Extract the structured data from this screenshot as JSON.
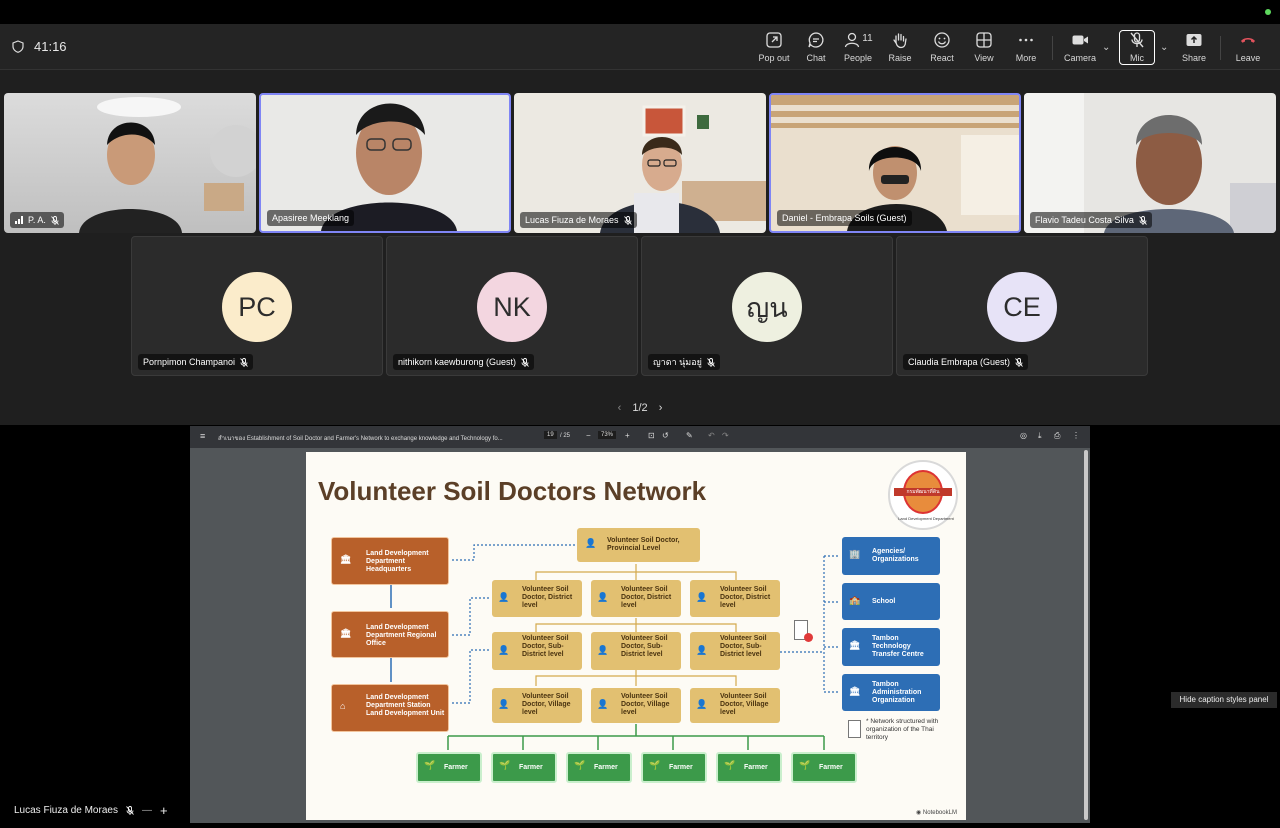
{
  "meeting": {
    "timer": "41:16",
    "pager": "1/2",
    "caption_tooltip": "Hide caption styles panel",
    "sharer_name": "Lucas Fiuza de Moraes"
  },
  "toolbar": [
    {
      "label": "Pop out",
      "icon": "pop-out-icon"
    },
    {
      "label": "Chat",
      "icon": "chat-icon"
    },
    {
      "label": "People",
      "icon": "people-icon",
      "count": "11"
    },
    {
      "label": "Raise",
      "icon": "raise-hand-icon"
    },
    {
      "label": "React",
      "icon": "react-icon"
    },
    {
      "label": "View",
      "icon": "view-icon"
    },
    {
      "label": "More",
      "icon": "more-icon"
    },
    {
      "label": "Camera",
      "icon": "camera-icon"
    },
    {
      "label": "Mic",
      "icon": "mic-off-icon"
    },
    {
      "label": "Share",
      "icon": "share-icon"
    },
    {
      "label": "Leave",
      "icon": "leave-icon"
    }
  ],
  "video_tiles": [
    {
      "name": "P. A.",
      "muted": true
    },
    {
      "name": "Apasiree Meeklang",
      "muted": false
    },
    {
      "name": "Lucas Fiuza de Moraes",
      "muted": true
    },
    {
      "name": "Daniel - Embrapa Soils (Guest)",
      "muted": false
    },
    {
      "name": "Flavio Tadeu Costa Silva",
      "muted": true
    }
  ],
  "avatar_tiles": [
    {
      "initials": "PC",
      "name": "Pornpimon Champanoi",
      "color": "#fbeccb"
    },
    {
      "initials": "NK",
      "name": "nithikorn kaewburong (Guest)",
      "color": "#f3d6e0"
    },
    {
      "initials": "ญน",
      "name": "ญาดา นุ่มอยู่",
      "color": "#eef0e0"
    },
    {
      "initials": "CE",
      "name": "Claudia Embrapa (Guest)",
      "color": "#e7e3f7"
    }
  ],
  "pdf": {
    "title": "สำเนาของ Establishment of Soil Doctor and Farmer's Network to exchange knowledge and Technology fo...",
    "page": "19",
    "total": "/ 25",
    "zoom": "73%"
  },
  "slide": {
    "title": "Volunteer Soil Doctors Network",
    "seal_text": "Land Development Department",
    "seal_thai": "กรมพัฒนาที่ดิน",
    "ldd": [
      "Land Development Department Headquarters",
      "Land Development Department Regional Office",
      "Land Development Department Station Land Development Unit"
    ],
    "provincial": "Volunteer Soil Doctor, Provincial Level",
    "district": "Volunteer Soil Doctor, District level",
    "subdistrict": "Volunteer Soil Doctor, Sub-District level",
    "village": "Volunteer Soil Doctor, Village level",
    "orgs": [
      "Agencies/ Organizations",
      "School",
      "Tambon Technology Transfer Centre",
      "Tambon Administration Organization"
    ],
    "note": "* Network structured with organization of the Thai territory",
    "farmer": "Farmer",
    "watermark": "NotebookLM"
  }
}
